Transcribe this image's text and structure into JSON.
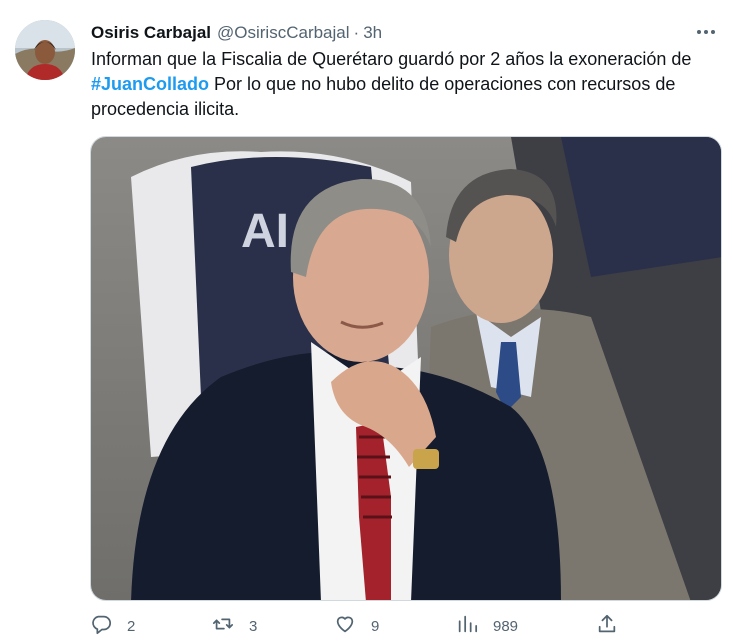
{
  "tweet": {
    "author_name": "Osiris Carbajal",
    "author_handle": "@OsiriscCarbajal",
    "separator": "·",
    "time": "3h",
    "more_icon": "more-horizontal-icon",
    "text_part1": "Informan que la Fiscalia de Querétaro guardó por 2 años la exoneración de ",
    "hashtag": "#JuanCollado",
    "text_part2": " Por lo que no hubo delito de operaciones con recursos de procedencia ilicita.",
    "hashtag_color": "#1d9bf0"
  },
  "actions": {
    "replies": "2",
    "retweets": "3",
    "likes": "9",
    "views": "989",
    "icons": [
      "reply-icon",
      "retweet-icon",
      "like-icon",
      "views-icon",
      "share-icon"
    ]
  },
  "colors": {
    "text": "#0f1419",
    "secondary": "#536471",
    "accent": "#1d9bf0"
  }
}
